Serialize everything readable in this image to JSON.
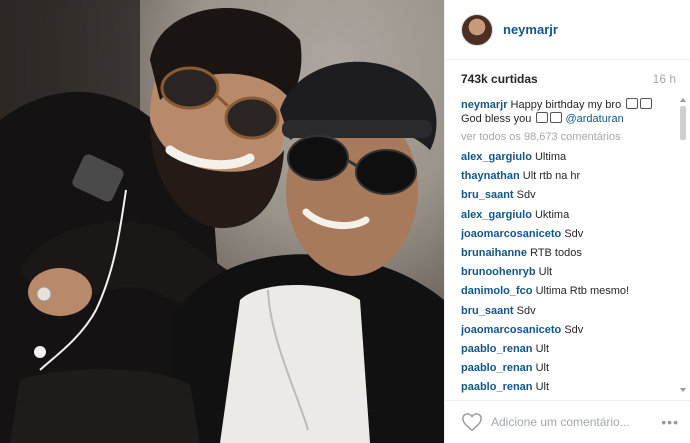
{
  "post": {
    "header": {
      "username": "neymarjr"
    },
    "stats": {
      "likes": "743k curtidas",
      "time": "16 h"
    },
    "caption": {
      "username": "neymarjr",
      "text": "Happy birthday my bro",
      "text2": "God bless you",
      "mention": "@ardaturan"
    },
    "view_all": "ver todos os 98,673 comentários",
    "comments": [
      {
        "user": "alex_gargiulo",
        "text": "Ultima"
      },
      {
        "user": "thaynathan",
        "text": "Ult rtb na hr"
      },
      {
        "user": "bru_saant",
        "text": "Sdv"
      },
      {
        "user": "alex_gargiulo",
        "text": "Uktima"
      },
      {
        "user": "joaomarcosaniceto",
        "text": "Sdv"
      },
      {
        "user": "brunaihanne",
        "text": "RTB todos"
      },
      {
        "user": "brunoohenryb",
        "text": "Ult"
      },
      {
        "user": "danimolo_fco",
        "text": "Ultima Rtb mesmo!"
      },
      {
        "user": "bru_saant",
        "text": "Sdv"
      },
      {
        "user": "joaomarcosaniceto",
        "text": "Sdv"
      },
      {
        "user": "paablo_renan",
        "text": "Ult"
      },
      {
        "user": "paablo_renan",
        "text": "Ult"
      },
      {
        "user": "paablo_renan",
        "text": "Ult"
      }
    ],
    "footer": {
      "add_comment_placeholder": "Adicione um comentário...",
      "more_label": "•••"
    },
    "colors": {
      "link": "#125688",
      "muted": "#a5a7aa"
    },
    "icons": [
      "heart-icon",
      "more-options-icon",
      "scroll-up-icon",
      "scroll-down-icon"
    ]
  }
}
